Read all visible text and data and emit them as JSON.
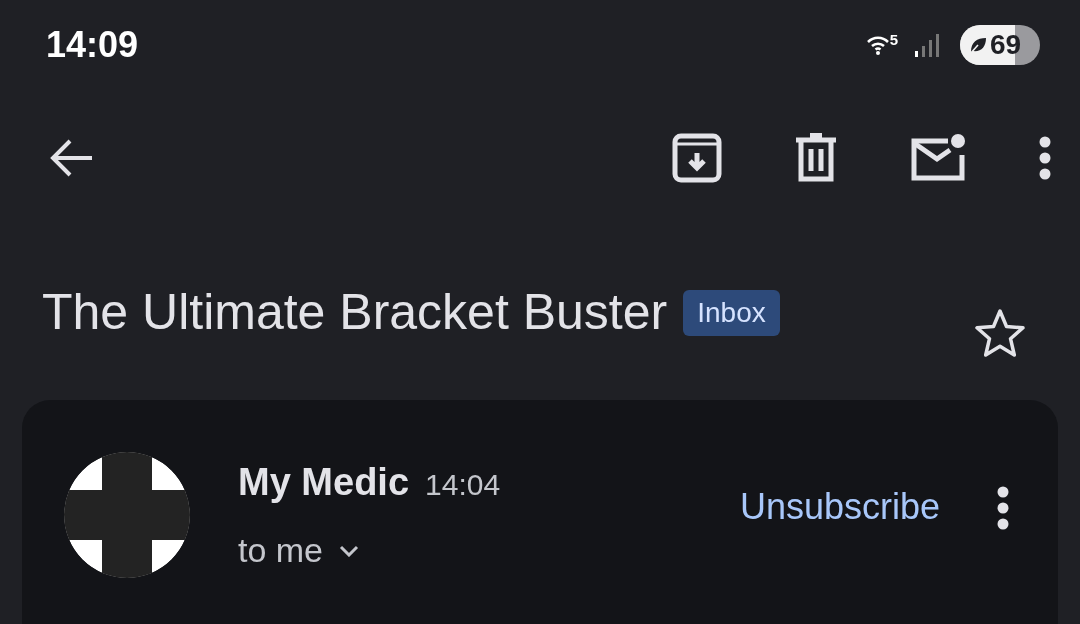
{
  "status_bar": {
    "time": "14:09",
    "wifi_badge": "5",
    "battery": {
      "text": "69",
      "level": 0.69,
      "saver": true
    }
  },
  "subject": {
    "title": "The Ultimate Bracket Buster",
    "label": "Inbox",
    "starred": false
  },
  "message": {
    "sender": "My Medic",
    "time": "14:04",
    "recipient": "to me",
    "unsubscribe": "Unsubscribe"
  }
}
